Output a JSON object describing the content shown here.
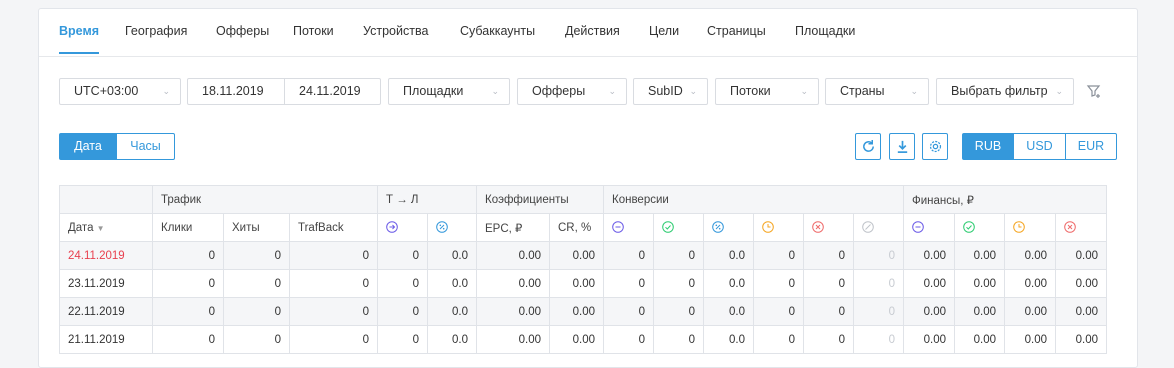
{
  "tabs": [
    {
      "label": "Время",
      "active": true
    },
    {
      "label": "География"
    },
    {
      "label": "Офферы"
    },
    {
      "label": "Потоки"
    },
    {
      "label": "Устройства"
    },
    {
      "label": "Субаккаунты"
    },
    {
      "label": "Действия"
    },
    {
      "label": "Цели"
    },
    {
      "label": "Страницы"
    },
    {
      "label": "Площадки"
    }
  ],
  "filters": {
    "timezone": "UTC+03:00",
    "date_from": "18.11.2019",
    "date_to": "24.11.2019",
    "platforms": "Площадки",
    "offers": "Офферы",
    "subid": "SubID",
    "streams": "Потоки",
    "countries": "Страны",
    "choose_filter": "Выбрать фильтр"
  },
  "group_toggle": {
    "date": "Дата",
    "hours": "Часы"
  },
  "currency": {
    "rub": "RUB",
    "usd": "USD",
    "eur": "EUR",
    "selected": "RUB"
  },
  "colors": {
    "accent": "#3498db",
    "today": "#e8404f",
    "purple": "#6c5ce7",
    "green": "#2ecc71",
    "blue": "#3498db",
    "orange": "#f5a623",
    "red": "#ef6b6b",
    "grey": "#c0c4ca"
  },
  "table": {
    "groups": {
      "traffic": "Трафик",
      "transition": "Т → Л",
      "coefficients": "Коэффициенты",
      "conversions": "Конверсии",
      "finance": "Финансы, ₽"
    },
    "columns": {
      "date": "Дата",
      "clicks": "Клики",
      "hits": "Хиты",
      "trafback": "TrafBack",
      "epc": "EPC, ₽",
      "cr": "CR, %"
    },
    "rows": [
      {
        "date": "24.11.2019",
        "today": true,
        "v": [
          "0",
          "0",
          "0",
          "0",
          "0.0",
          "0.00",
          "0.00",
          "0",
          "0",
          "0.0",
          "0",
          "0",
          "0",
          "0.00",
          "0.00",
          "0.00",
          "0.00"
        ]
      },
      {
        "date": "23.11.2019",
        "today": false,
        "v": [
          "0",
          "0",
          "0",
          "0",
          "0.0",
          "0.00",
          "0.00",
          "0",
          "0",
          "0.0",
          "0",
          "0",
          "0",
          "0.00",
          "0.00",
          "0.00",
          "0.00"
        ]
      },
      {
        "date": "22.11.2019",
        "today": false,
        "v": [
          "0",
          "0",
          "0",
          "0",
          "0.0",
          "0.00",
          "0.00",
          "0",
          "0",
          "0.0",
          "0",
          "0",
          "0",
          "0.00",
          "0.00",
          "0.00",
          "0.00"
        ]
      },
      {
        "date": "21.11.2019",
        "today": false,
        "v": [
          "0",
          "0",
          "0",
          "0",
          "0.0",
          "0.00",
          "0.00",
          "0",
          "0",
          "0.0",
          "0",
          "0",
          "0",
          "0.00",
          "0.00",
          "0.00",
          "0.00"
        ]
      }
    ]
  }
}
